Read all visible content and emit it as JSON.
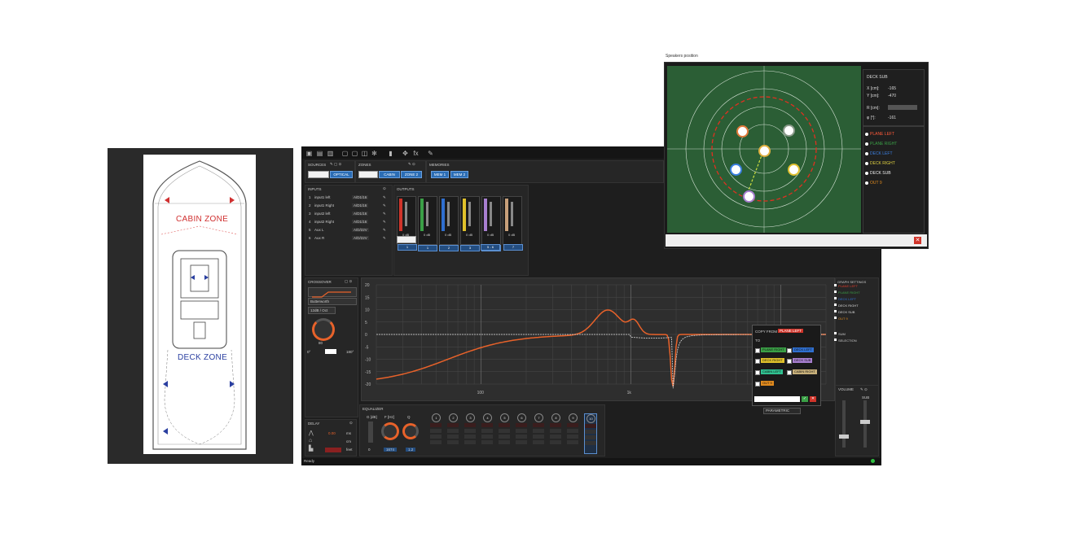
{
  "boat": {
    "cabin_zone": "CABIN ZONE",
    "deck_zone": "DECK ZONE"
  },
  "toolbar": {
    "icons": [
      "folder-icon",
      "save-icon",
      "save-as-icon",
      "copy-icon",
      "paste-icon",
      "undo-icon",
      "settings-icon",
      "meter-icon",
      "move-icon",
      "fx-icon",
      "edit-icon"
    ],
    "fx": "fx"
  },
  "sources": {
    "title": "SOURCES",
    "selected": "OPTICAL"
  },
  "zones": {
    "title": "ZONES",
    "items": [
      "CABIN",
      "ZONE 2"
    ]
  },
  "memories": {
    "title": "MEMORIES",
    "items": [
      "MEM 1",
      "MEM 2"
    ]
  },
  "inputs": {
    "title": "INPUTS",
    "rows": [
      {
        "n": "1",
        "name": "input1 left",
        "src": "A/D1/16"
      },
      {
        "n": "2",
        "name": "input1 Right",
        "src": "A/D1/16"
      },
      {
        "n": "3",
        "name": "input2 left",
        "src": "A/D1/16"
      },
      {
        "n": "4",
        "name": "input2 Right",
        "src": "A/D1/16"
      },
      {
        "n": "5",
        "name": "Aux L",
        "src": "A/D/22V"
      },
      {
        "n": "6",
        "name": "Aux R",
        "src": "A/D/22V"
      }
    ]
  },
  "outputs": {
    "title": "OUTPUTS",
    "gain": "0 dB",
    "channels": [
      "1",
      "2",
      "3",
      "4",
      "5 - 6",
      "7"
    ]
  },
  "crossover": {
    "title": "CROSSOVER",
    "type": "Butterworth",
    "slope": "12dB / Oct",
    "freq": "80",
    "phase_0": "0°",
    "phase_180": "180°"
  },
  "graph": {
    "y_ticks": [
      "20",
      "15",
      "10",
      "5",
      "0",
      "-5",
      "-10",
      "-15",
      "-20"
    ],
    "x_ticks": [
      "100",
      "1k"
    ]
  },
  "graph_settings": {
    "title": "GRAPH SETTINGS",
    "items": [
      {
        "label": "PLANE LEFT",
        "color": "#e03b2b"
      },
      {
        "label": "PLANE RIGHT",
        "color": "#3aa046"
      },
      {
        "label": "DECK LEFT",
        "color": "#2f6fd0"
      },
      {
        "label": "DECK RIGHT",
        "color": "#d9d9d9"
      },
      {
        "label": "DECK SUB",
        "color": "#d9d9d9"
      },
      {
        "label": "OUT 9",
        "color": "#e08a1e"
      }
    ],
    "sum": "SUM",
    "selection": "SELECTION"
  },
  "copy_popup": {
    "title": "COPY FROM",
    "source": "PLANE LEFT",
    "to": "TO",
    "targets": [
      {
        "label": "PLANE RIGHT",
        "color": "#3aa046"
      },
      {
        "label": "DECK LEFT",
        "color": "#2f6fd0"
      },
      {
        "label": "DECK RIGHT",
        "color": "#e0c12b"
      },
      {
        "label": "DECK SUB",
        "color": "#a87fd0"
      },
      {
        "label": "CABIN LEFT",
        "color": "#30c090"
      },
      {
        "label": "CABIN RIGHT",
        "color": "#c8b07a"
      },
      {
        "label": "OUT 9",
        "color": "#e08a1e"
      }
    ]
  },
  "equalizer": {
    "title": "EQUALIZER",
    "gain_label": "G [dB]",
    "freq_label": "F [Hz]",
    "q_label": "Q",
    "gain_val": "0",
    "freq_val": "1674",
    "q_val": "1.2",
    "bands": [
      "1",
      "2",
      "3",
      "4",
      "5",
      "6",
      "7",
      "8",
      "9",
      "10"
    ],
    "mode": "PARAMETRIC"
  },
  "delay": {
    "title": "DELAY",
    "ms": "ms",
    "cm": "cm",
    "feet": "feet",
    "value": "0.00"
  },
  "volume": {
    "title": "VOLUME",
    "sub": "SUB"
  },
  "status": {
    "ready": "Ready"
  },
  "speaker_window": {
    "title": "Speakers position",
    "selected": "DECK SUB",
    "x_label": "X [cm]:",
    "x_val": "-165",
    "y_label": "Y [cm]:",
    "y_val": "-470",
    "r_label": "R [cm]:",
    "phi_label": "φ [°]:",
    "phi_val": "-161",
    "list": [
      {
        "label": "PLANE LEFT",
        "color": "#ff5a3a"
      },
      {
        "label": "PLANE RIGHT",
        "color": "#3aa046"
      },
      {
        "label": "DECK LEFT",
        "color": "#3b7fe0"
      },
      {
        "label": "DECK RIGHT",
        "color": "#e0d040"
      },
      {
        "label": "DECK SUB",
        "color": "#f0f0f0"
      },
      {
        "label": "OUT 9",
        "color": "#e08a1e"
      }
    ]
  }
}
